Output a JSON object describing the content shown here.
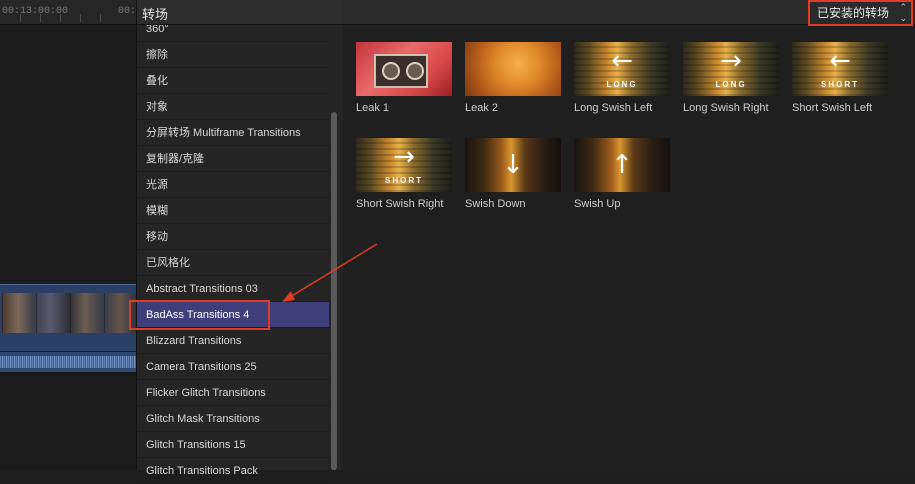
{
  "timeline": {
    "timecode_left": "00:13:00:00",
    "timecode_right": "00:"
  },
  "panel": {
    "title": "转场"
  },
  "categories": [
    "360°",
    "擦除",
    "叠化",
    "对象",
    "分屏转场 Multiframe Transitions",
    "复制器/克隆",
    "光源",
    "模糊",
    "移动",
    "已风格化",
    "Abstract Transitions 03",
    "BadAss Transitions 4",
    "Blizzard Transitions",
    "Camera Transitions 25",
    "Flicker Glitch Transitions",
    "Glitch Mask Transitions",
    "Glitch Transitions 15",
    "Glitch Transitions Pack"
  ],
  "selected_category": "BadAss Transitions 4",
  "browser": {
    "filter_label": "已安装的转场"
  },
  "transitions": [
    {
      "name": "Leak 1",
      "style": "leak1"
    },
    {
      "name": "Leak 2",
      "style": "leak2"
    },
    {
      "name": "Long Swish Left",
      "style": "swish",
      "arrow": "←",
      "word": "LONG"
    },
    {
      "name": "Long Swish Right",
      "style": "swish",
      "arrow": "→",
      "word": "LONG"
    },
    {
      "name": "Short Swish Left",
      "style": "swish",
      "arrow": "←",
      "word": "SHORT"
    },
    {
      "name": "Short Swish Right",
      "style": "swish",
      "arrow": "→",
      "word": "SHORT"
    },
    {
      "name": "Swish Down",
      "style": "swishv",
      "arrow": "↓",
      "word": ""
    },
    {
      "name": "Swish Up",
      "style": "swishv",
      "arrow": "↑",
      "word": ""
    }
  ],
  "colors": {
    "selection": "#3e3f7a",
    "annotation": "#e03b25"
  }
}
